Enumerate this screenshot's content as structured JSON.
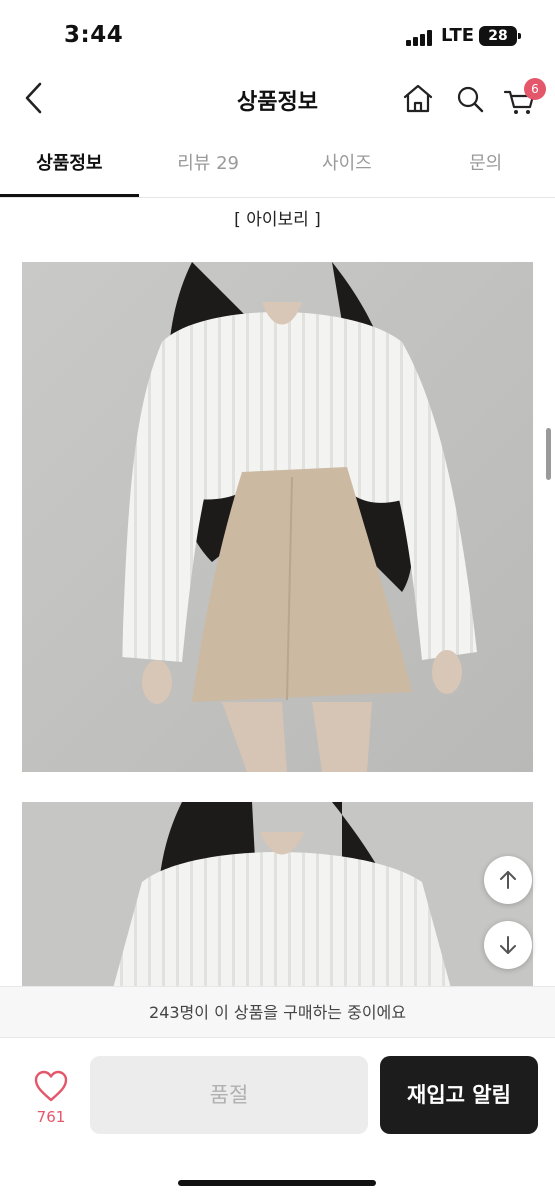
{
  "status_bar": {
    "time": "3:44",
    "network": "LTE",
    "battery": "28"
  },
  "header": {
    "title": "상품정보",
    "cart_count": "6",
    "icons": [
      "chevron-left-icon",
      "home-icon",
      "search-icon",
      "cart-icon"
    ]
  },
  "tabs": [
    {
      "label": "상품정보",
      "active": true
    },
    {
      "label": "리뷰 29",
      "active": false
    },
    {
      "label": "사이즈",
      "active": false
    },
    {
      "label": "문의",
      "active": false
    }
  ],
  "content": {
    "color_label": "[ 아이보리 ]"
  },
  "purchase_notice": "243명이 이 상품을 구매하는 중이에요",
  "bottom": {
    "like_count": "761",
    "soldout_label": "품절",
    "restock_label": "재입고 알림"
  },
  "colors": {
    "accent": "#e4566a",
    "dark_button": "#1c1c1c",
    "disabled_button": "#ececec"
  }
}
